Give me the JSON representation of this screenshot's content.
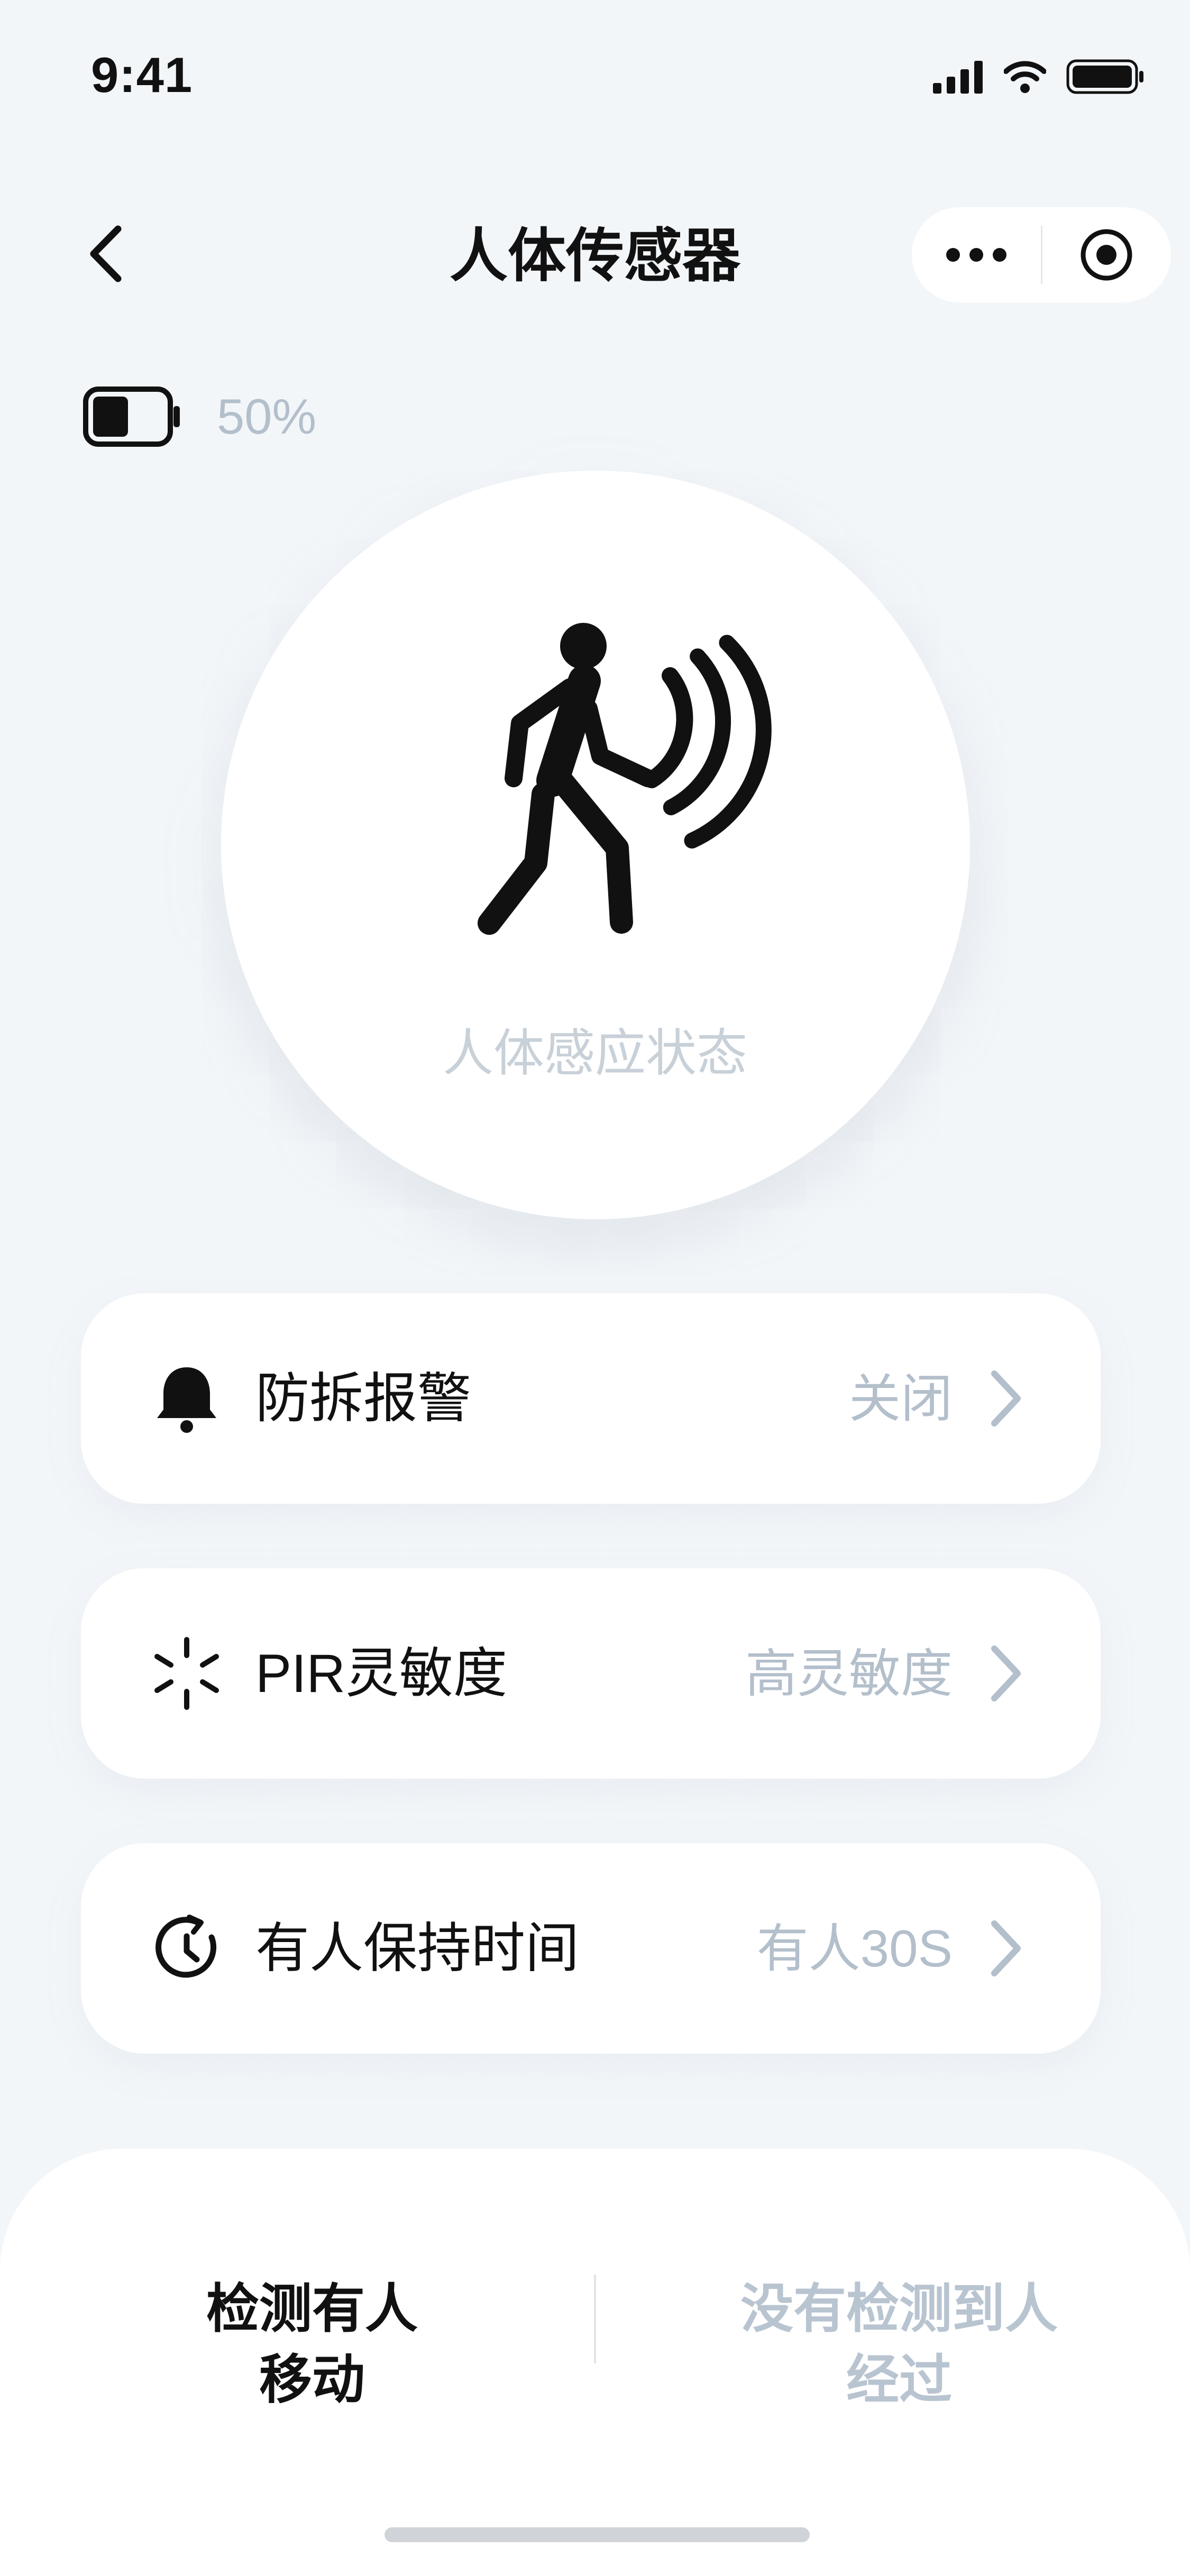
{
  "status_bar": {
    "time": "9:41"
  },
  "header": {
    "title": "人体传感器",
    "more_icon": "more-dots-icon",
    "target_icon": "target-icon"
  },
  "battery": {
    "percent": "50%",
    "level": 0.5
  },
  "hero": {
    "icon": "person-walking-motion-icon",
    "label": "人体感应状态"
  },
  "settings": [
    {
      "icon": "bell-icon",
      "label": "防拆报警",
      "value": "关闭"
    },
    {
      "icon": "sensitivity-burst-icon",
      "label": "PIR灵敏度",
      "value": "高灵敏度"
    },
    {
      "icon": "timer-icon",
      "label": "有人保持时间",
      "value": "有人30S"
    }
  ],
  "bottom": {
    "left_line1": "检测有人",
    "left_line2": "移动",
    "right_line1": "没有检测到人",
    "right_line2": "经过"
  },
  "colors": {
    "background": "#f3f6f9",
    "muted_text": "#b3bfcb",
    "primary_text": "#111111"
  }
}
